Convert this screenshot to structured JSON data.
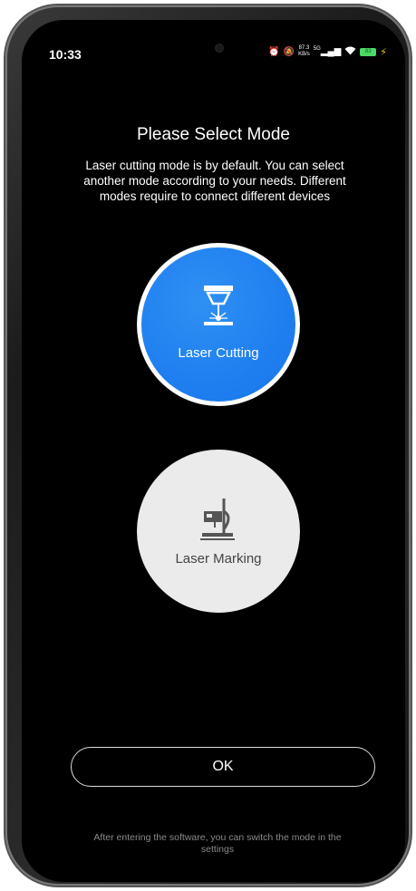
{
  "status_bar": {
    "time": "10:33",
    "net_speed_top": "87.3",
    "net_speed_bottom": "KB/s",
    "network": "5G",
    "battery": "83"
  },
  "header": {
    "title": "Please Select Mode",
    "description": "Laser cutting mode is by default. You can select another mode according to your needs. Different modes require to connect different devices"
  },
  "modes": [
    {
      "label": "Laser Cutting",
      "icon": "laser-cutting-icon",
      "selected": true,
      "color": "#1f7ff0"
    },
    {
      "label": "Laser Marking",
      "icon": "laser-marking-icon",
      "selected": false,
      "color": "#ebebeb"
    }
  ],
  "actions": {
    "ok_label": "OK"
  },
  "footer": {
    "note": "After entering the software, you can switch the mode in the settings"
  }
}
